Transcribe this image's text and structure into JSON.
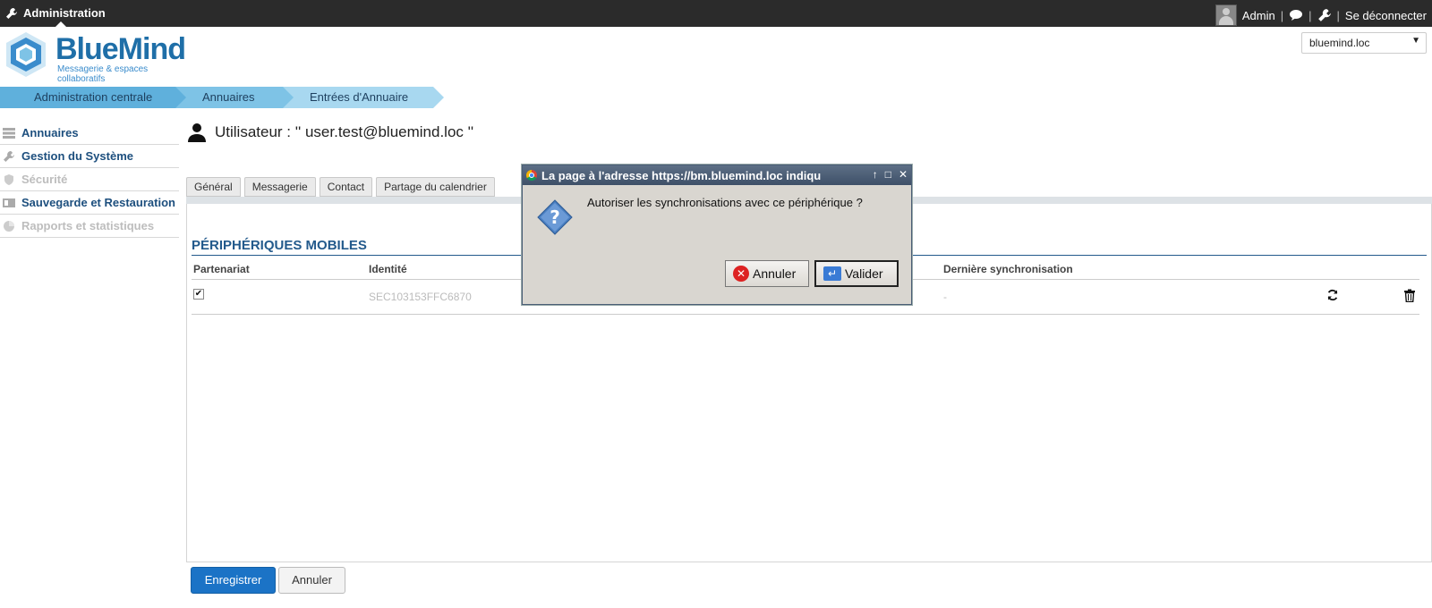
{
  "topbar": {
    "app_title": "Administration",
    "user_name": "Admin",
    "logout": "Se déconnecter",
    "separator": "|"
  },
  "logo": {
    "title": "BlueMind",
    "subtitle": "Messagerie & espaces collaboratifs"
  },
  "domain_select": {
    "value": "bluemind.loc"
  },
  "breadcrumb": [
    "Administration centrale",
    "Annuaires",
    "Entrées d'Annuaire"
  ],
  "sidebar": {
    "items": [
      {
        "label": "Annuaires",
        "icon": "list-icon",
        "enabled": true
      },
      {
        "label": "Gestion du Système",
        "icon": "wrench-icon",
        "enabled": true
      },
      {
        "label": "Sécurité",
        "icon": "shield-icon",
        "enabled": false
      },
      {
        "label": "Sauvegarde et Restauration",
        "icon": "backup-icon",
        "enabled": true
      },
      {
        "label": "Rapports et statistiques",
        "icon": "chart-icon",
        "enabled": false
      }
    ]
  },
  "page": {
    "title": "Utilisateur : '' user.test@bluemind.loc ''"
  },
  "tabs": [
    "Général",
    "Messagerie",
    "Contact",
    "Partage du calendrier"
  ],
  "section": {
    "title": "PÉRIPHÉRIQUES MOBILES",
    "columns": [
      "Partenariat",
      "Identité",
      "Dernière synchronisation"
    ],
    "rows": [
      {
        "partnership_checked": true,
        "identity": "SEC103153FFC6870",
        "last_sync": "-"
      }
    ]
  },
  "footer": {
    "save": "Enregistrer",
    "cancel": "Annuler"
  },
  "dialog": {
    "title": "La page à l'adresse https://bm.bluemind.loc indiqu",
    "message": "Autoriser les synchronisations avec ce périphérique ?",
    "cancel_label": "Annuler",
    "ok_label": "Valider"
  },
  "colors": {
    "accent": "#1b73c6",
    "section_title": "#235a8c",
    "topbar": "#2b2b2b"
  }
}
